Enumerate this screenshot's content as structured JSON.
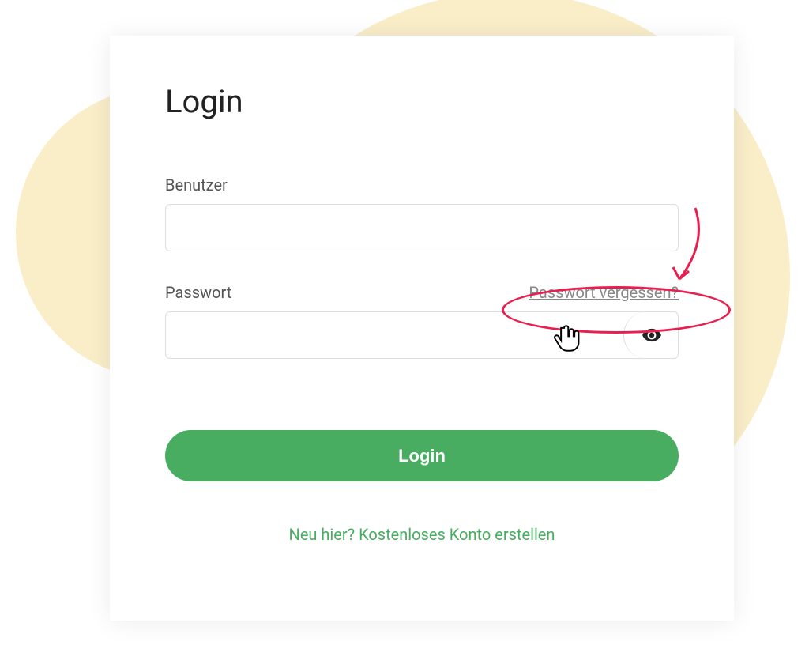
{
  "page": {
    "title": "Login"
  },
  "fields": {
    "username": {
      "label": "Benutzer",
      "value": ""
    },
    "password": {
      "label": "Passwort",
      "value": "",
      "forgot_label": "Passwort vergessen?"
    }
  },
  "buttons": {
    "login": "Login",
    "signup": "Neu hier? Kostenloses Konto erstellen"
  }
}
